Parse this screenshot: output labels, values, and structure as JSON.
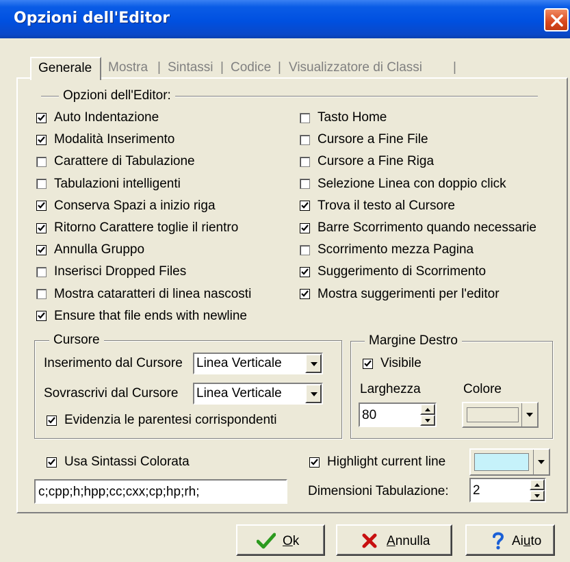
{
  "window": {
    "title": "Opzioni dell'Editor"
  },
  "tabs": [
    {
      "label": "Generale",
      "active": true
    },
    {
      "label": "Mostra",
      "active": false
    },
    {
      "label": "Sintassi",
      "active": false
    },
    {
      "label": "Codice",
      "active": false
    },
    {
      "label": "Visualizzatore di Classi",
      "active": false
    }
  ],
  "tab_separator": "|",
  "editor_options": {
    "group_label": "Opzioni dell'Editor:",
    "left": [
      {
        "label": "Auto Indentazione",
        "checked": true
      },
      {
        "label": "Modalità Inserimento",
        "checked": true
      },
      {
        "label": "Carattere di Tabulazione",
        "checked": false
      },
      {
        "label": "Tabulazioni intelligenti",
        "checked": false
      },
      {
        "label": "Conserva Spazi a inizio riga",
        "checked": true
      },
      {
        "label": "Ritorno Carattere toglie il rientro",
        "checked": true
      },
      {
        "label": "Annulla Gruppo",
        "checked": true
      },
      {
        "label": "Inserisci Dropped Files",
        "checked": false
      },
      {
        "label": "Mostra cataratteri di linea nascosti",
        "checked": false
      },
      {
        "label": "Ensure that file ends with newline",
        "checked": true
      }
    ],
    "right": [
      {
        "label": "Tasto Home",
        "checked": false
      },
      {
        "label": "Cursore a Fine File",
        "checked": false
      },
      {
        "label": "Cursore a Fine Riga",
        "checked": false
      },
      {
        "label": "Selezione Linea con doppio click",
        "checked": false
      },
      {
        "label": "Trova il testo al Cursore",
        "checked": true
      },
      {
        "label": "Barre Scorrimento quando necessarie",
        "checked": true
      },
      {
        "label": "Scorrimento mezza Pagina",
        "checked": false
      },
      {
        "label": "Suggerimento di Scorrimento",
        "checked": true
      },
      {
        "label": "Mostra suggerimenti per l'editor",
        "checked": true
      }
    ]
  },
  "cursor": {
    "group_label": "Cursore",
    "insert_label": "Inserimento dal Cursore",
    "insert_value": "Linea Verticale",
    "overwrite_label": "Sovrascrivi dal Cursore",
    "overwrite_value": "Linea Verticale",
    "match_brackets_label": "Evidenzia le parentesi corrispondenti",
    "match_brackets_checked": true
  },
  "right_margin": {
    "group_label": "Margine Destro",
    "visible_label": "Visibile",
    "visible_checked": true,
    "width_label": "Larghezza",
    "width_value": "80",
    "color_label": "Colore",
    "color_value": "#ece9d8"
  },
  "syntax": {
    "use_syntax_label": "Usa Sintassi Colorata",
    "use_syntax_checked": true,
    "extensions_value": "c;cpp;h;hpp;cc;cxx;cp;hp;rh;",
    "highlight_line_label": "Highlight current line",
    "highlight_line_checked": true,
    "highlight_color": "#c6f2fa",
    "tab_size_label": "Dimensioni Tabulazione:",
    "tab_size_value": "2"
  },
  "buttons": {
    "ok_mnemonic": "O",
    "ok_rest": "k",
    "cancel_mnemonic": "A",
    "cancel_rest": "nnulla",
    "help_pre": "Ai",
    "help_mnemonic": "u",
    "help_rest": "to"
  },
  "colors": {
    "titlebar": "#0054e3",
    "dialog_bg": "#ece9d8",
    "ok_icon": "#2c9a1e",
    "cancel_icon": "#c81010",
    "help_icon": "#1a5fd6"
  }
}
